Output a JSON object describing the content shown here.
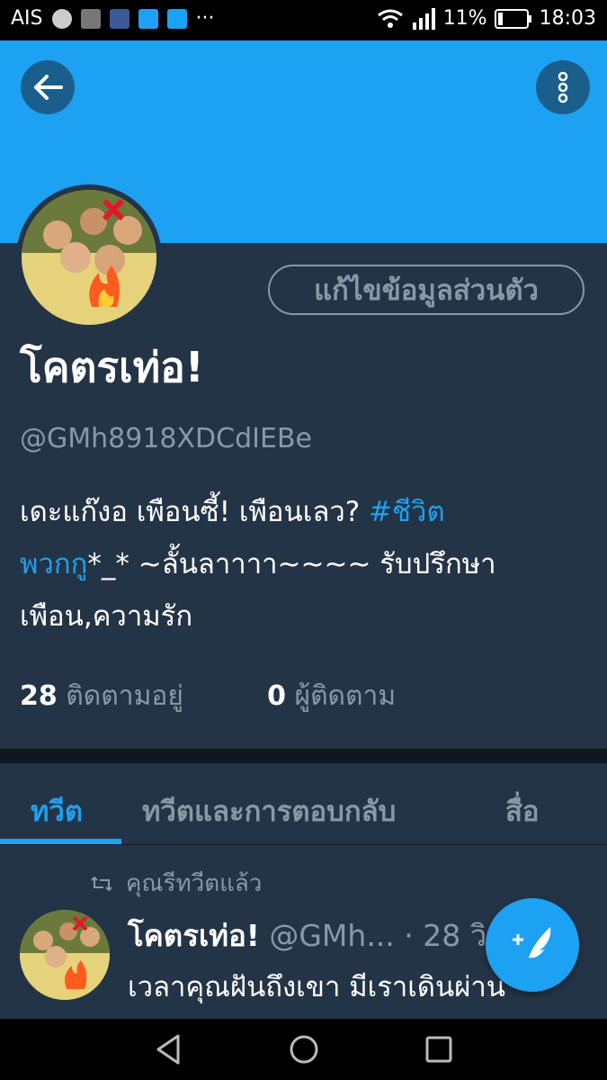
{
  "status_bar": {
    "carrier": "AIS",
    "battery": "11%",
    "time": "18:03",
    "more": "···"
  },
  "header": {
    "back_icon": "arrow-left-icon",
    "menu_icon": "more-vertical-icon"
  },
  "profile": {
    "edit_label": "แก้ไขข้อมูลส่วนตัว",
    "name": "โคตรเท่อ!",
    "handle": "@GMh8918XDCdIEBe",
    "bio_1": "เดะแก๊งอ เพือนซี้! เพือนเลว? ",
    "bio_tag_1": "#ชีวิต",
    "bio_tag_2": "พวกกู",
    "bio_2": "*_* ~ลั้นลาาาา~~~~ รับปรึกษา",
    "bio_3": "เพือน,ความรัก",
    "following_count": "28",
    "following_label": "ติดตามอยู่",
    "followers_count": "0",
    "followers_label": "ผู้ติดตาม"
  },
  "tabs": {
    "tweets": "ทวีต",
    "replies": "ทวีตและการตอบกลับ",
    "media": "สื่อ"
  },
  "tweet": {
    "retweet_label": "คุณรีทวีตแล้ว",
    "name": "โคตรเท่อ!",
    "handle": "@GMh...",
    "time": "· 28 วิ",
    "body": "เวลาคุณฝันถึงเขา มีเราเดินผ่าน"
  },
  "colors": {
    "accent": "#1da1f2",
    "background": "#243447",
    "muted": "#8899a6"
  }
}
